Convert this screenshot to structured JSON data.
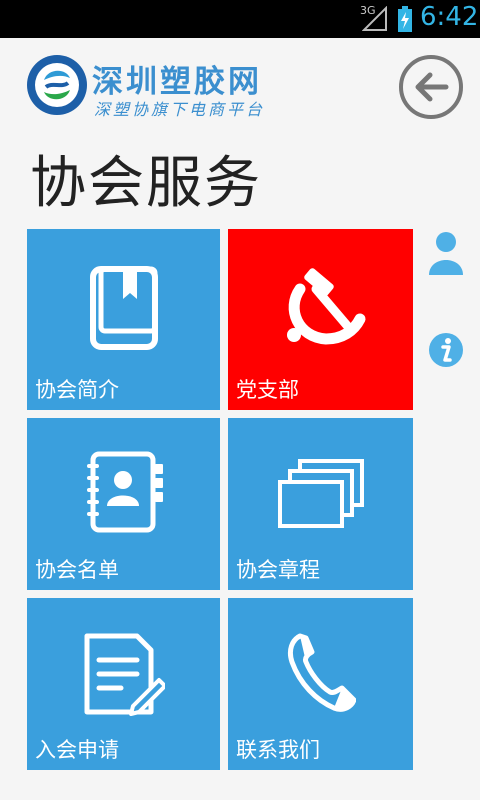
{
  "status_bar": {
    "network": "3G",
    "time": "6:42",
    "accent": "#33b5e5"
  },
  "header": {
    "logo_icon": "association-logo-icon",
    "brand_title": "深圳塑胶网",
    "brand_subtitle": "深塑协旗下电商平台",
    "back_icon": "back-arrow-icon"
  },
  "page": {
    "title": "协会服务"
  },
  "tiles": [
    {
      "label": "协会简介",
      "icon": "book-icon",
      "color": "#3a9fdd"
    },
    {
      "label": "党支部",
      "icon": "hammer-sickle-icon",
      "color": "#ff0000"
    },
    {
      "label": "协会名单",
      "icon": "contacts-book-icon",
      "color": "#3a9fdd"
    },
    {
      "label": "协会章程",
      "icon": "stacked-documents-icon",
      "color": "#3a9fdd"
    },
    {
      "label": "入会申请",
      "icon": "application-form-icon",
      "color": "#3a9fdd"
    },
    {
      "label": "联系我们",
      "icon": "phone-icon",
      "color": "#3a9fdd"
    }
  ],
  "side_icons": [
    {
      "icon": "user-icon"
    },
    {
      "icon": "info-icon"
    }
  ],
  "colors": {
    "brand_blue": "#3b8fcf",
    "tile_blue": "#3a9fdd",
    "tile_red": "#ff0000",
    "background": "#f5f5f5"
  }
}
